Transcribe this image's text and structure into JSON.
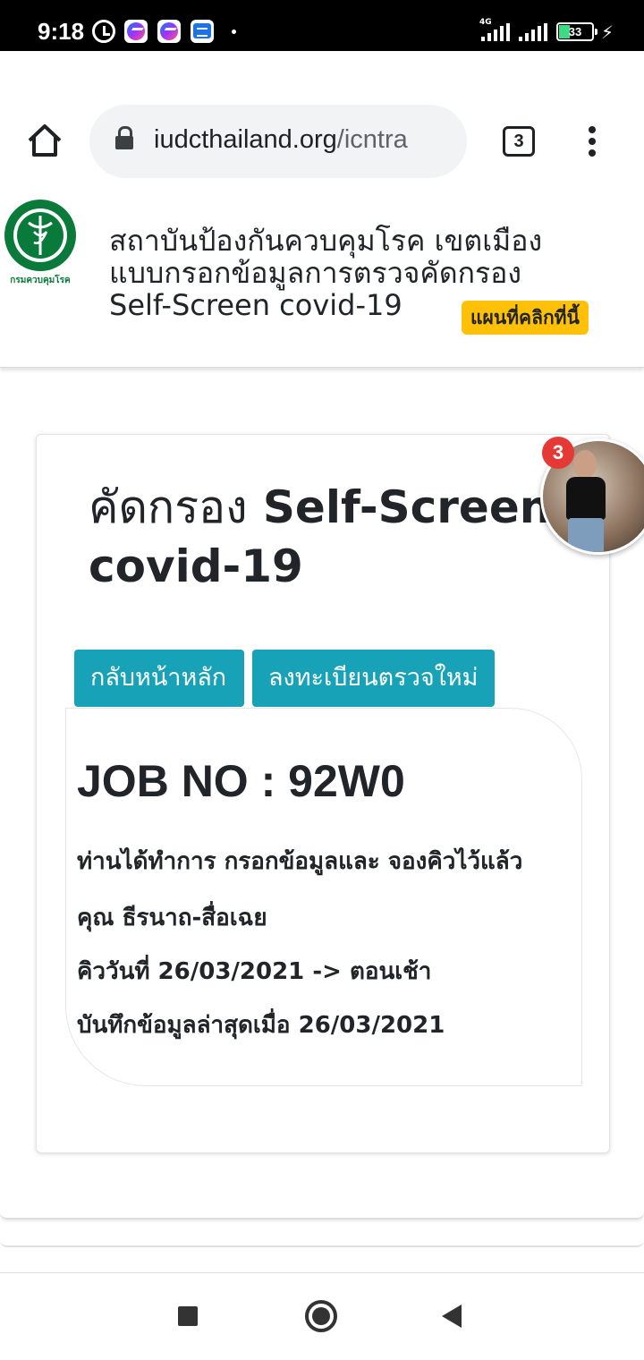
{
  "status_bar": {
    "time": "9:18",
    "network": "4G",
    "battery": "33",
    "icons": [
      "alarm-icon",
      "messenger-icon",
      "messenger-icon",
      "message-icon"
    ]
  },
  "browser": {
    "url_domain": "iudcthailand.org",
    "url_path": "/icntra",
    "tab_count": "3"
  },
  "site_header": {
    "line1": "สถาบันป้องกันควบคุมโรค เขตเมือง",
    "line2": "แบบกรอกข้อมูลการตรวจคัดกรอง",
    "line3": "Self-Screen covid-19",
    "map_badge": "แผนที่คลิกที่นี้",
    "logo_caption": "กรมควบคุมโรค"
  },
  "card": {
    "title_thai": "คัดกรอง",
    "title_en": "Self-Screen covid-19",
    "buttons": {
      "home": "กลับหน้าหลัก",
      "register": "ลงทะเบียนตรวจใหม่"
    },
    "job_no": "JOB NO : 92W0",
    "lines": [
      "ท่านได้ทำการ กรอกข้อมูลและ จองคิวไว้แล้ว",
      "คุณ ธีรนาถ-สื่อเฉย",
      "คิววันที่ 26/03/2021 -> ตอนเช้า",
      "บันทึกข้อมูลล่าสุดเมื่อ 26/03/2021"
    ]
  },
  "chat_head": {
    "badge": "3"
  },
  "colors": {
    "accent": "#17a2b8",
    "badge_yellow": "#ffc107",
    "logo_green": "#0a7a3b",
    "chat_badge": "#e53935"
  }
}
